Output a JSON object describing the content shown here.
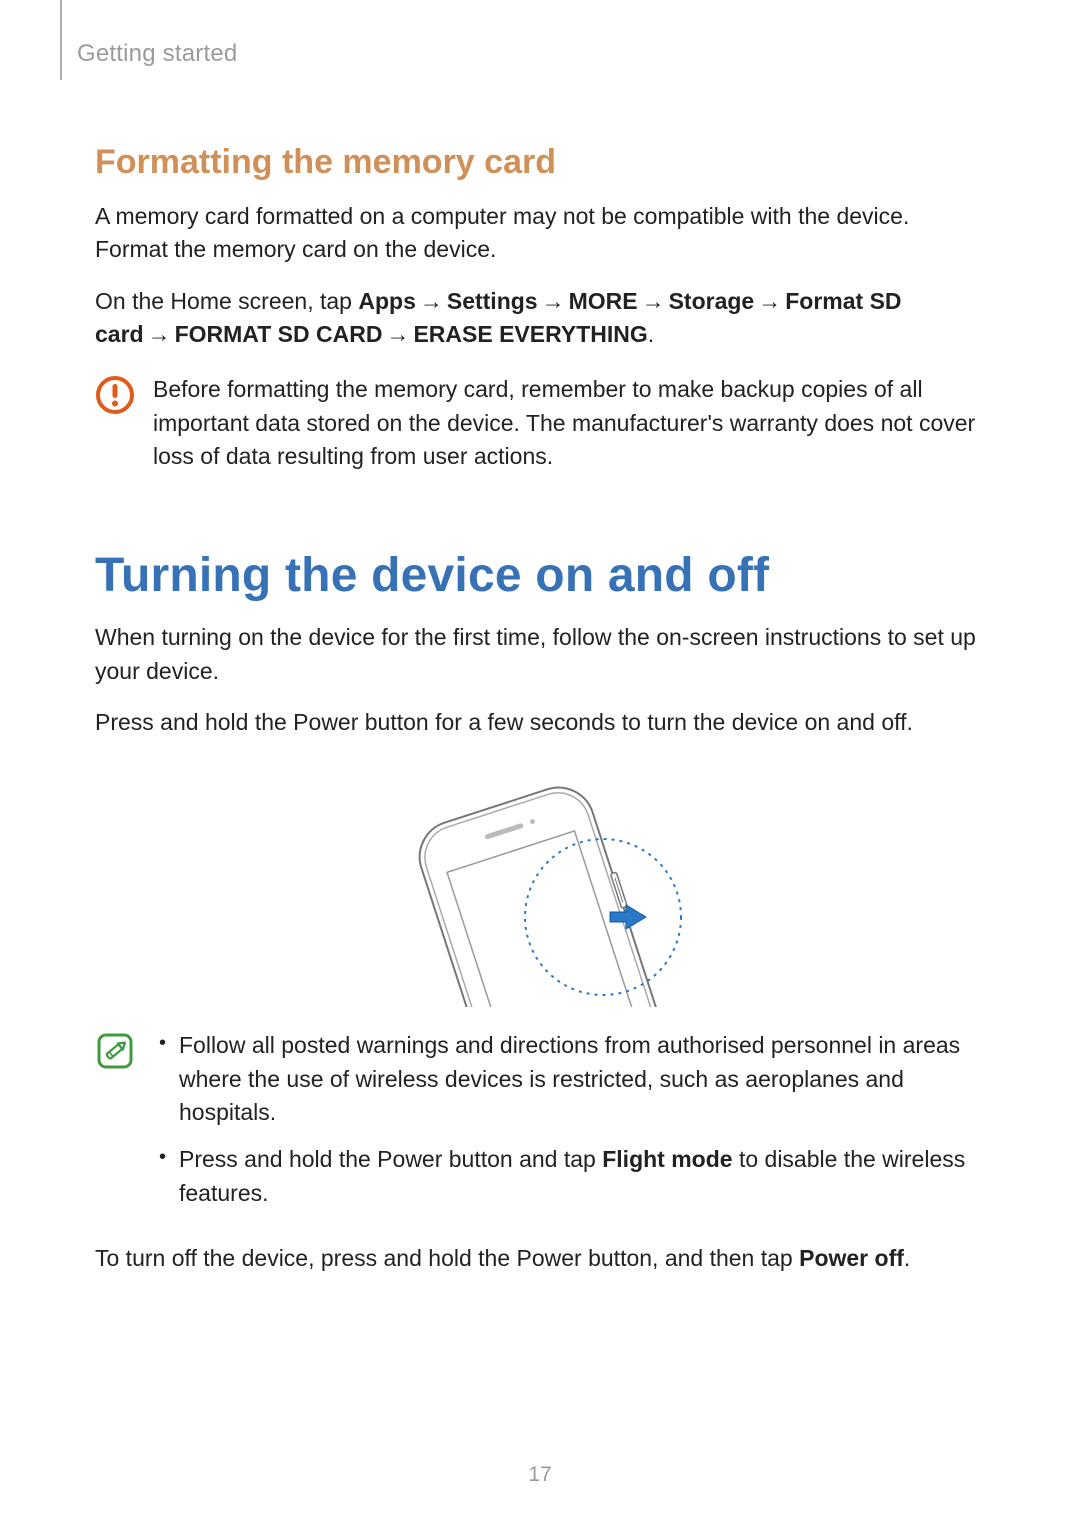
{
  "chapter": "Getting started",
  "section1": {
    "heading": "Formatting the memory card",
    "para1": "A memory card formatted on a computer may not be compatible with the device. Format the memory card on the device.",
    "path_prefix": "On the Home screen, tap ",
    "path_steps": [
      "Apps",
      "Settings",
      "MORE",
      "Storage",
      "Format SD card",
      "FORMAT SD CARD",
      "ERASE EVERYTHING"
    ],
    "path_suffix": ".",
    "arrow": "→",
    "warning": "Before formatting the memory card, remember to make backup copies of all important data stored on the device. The manufacturer's warranty does not cover loss of data resulting from user actions."
  },
  "section2": {
    "heading": "Turning the device on and off",
    "para1": "When turning on the device for the first time, follow the on-screen instructions to set up your device.",
    "para2": "Press and hold the Power button for a few seconds to turn the device on and off.",
    "note_li1": "Follow all posted warnings and directions from authorised personnel in areas where the use of wireless devices is restricted, such as aeroplanes and hospitals.",
    "note_li2_pre": "Press and hold the Power button and tap ",
    "note_li2_bold": "Flight mode",
    "note_li2_post": " to disable the wireless features.",
    "para3_pre": "To turn off the device, press and hold the Power button, and then tap ",
    "para3_bold": "Power off",
    "para3_post": "."
  },
  "page_number": "17"
}
